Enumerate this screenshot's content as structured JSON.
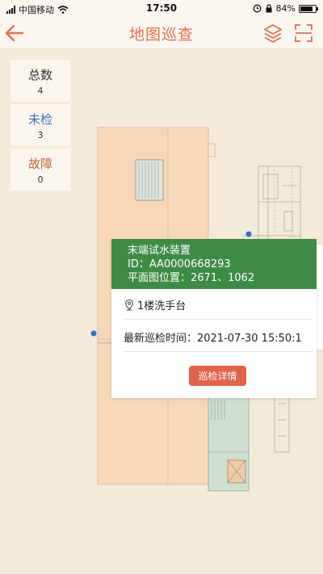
{
  "status_bar": {
    "carrier": "中国移动",
    "time": "17:50",
    "battery": "84%",
    "battery_level": 0.84
  },
  "header": {
    "title": "地图巡查"
  },
  "stats": [
    {
      "label": "总数",
      "value": "4",
      "color": "#333333"
    },
    {
      "label": "未检",
      "value": "3",
      "color": "#3a6fc2"
    },
    {
      "label": "故障",
      "value": "0",
      "color": "#c6663e"
    }
  ],
  "popup": {
    "name": "末端试水装置",
    "id_line": "ID：AA0000668293",
    "position_line": "平面图位置：2671、1062",
    "location": "1楼洗手台",
    "latest_inspection": "最新巡检时间：2021-07-30 15:50:1",
    "detail_button": "巡检详情",
    "header_color": "#3e8b45",
    "button_color": "#e0634a"
  },
  "icons": {
    "back": "back-arrow-icon",
    "layers": "layers-icon",
    "scan": "scan-icon",
    "location": "location-pin-icon",
    "collapse": "chevron-left-icon"
  }
}
